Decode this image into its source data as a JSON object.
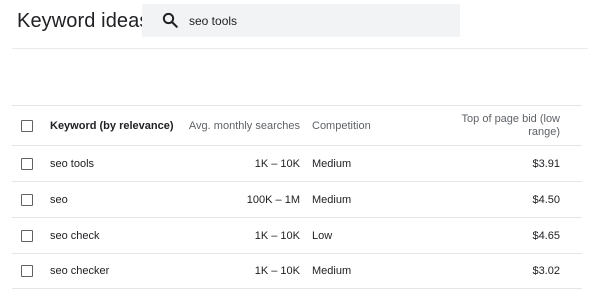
{
  "header": {
    "title": "Keyword ideas",
    "search": {
      "value": "seo tools",
      "icon": "search-icon"
    }
  },
  "table": {
    "columns": {
      "keyword": "Keyword (by relevance)",
      "searches": "Avg. monthly searches",
      "competition": "Competition",
      "bid": "Top of page bid (low range)"
    },
    "rows": [
      {
        "keyword": "seo tools",
        "searches": "1K – 10K",
        "competition": "Medium",
        "bid": "$3.91"
      },
      {
        "keyword": "seo",
        "searches": "100K – 1M",
        "competition": "Medium",
        "bid": "$4.50"
      },
      {
        "keyword": "seo check",
        "searches": "1K – 10K",
        "competition": "Low",
        "bid": "$4.65"
      },
      {
        "keyword": "seo checker",
        "searches": "1K – 10K",
        "competition": "Medium",
        "bid": "$3.02"
      }
    ]
  }
}
